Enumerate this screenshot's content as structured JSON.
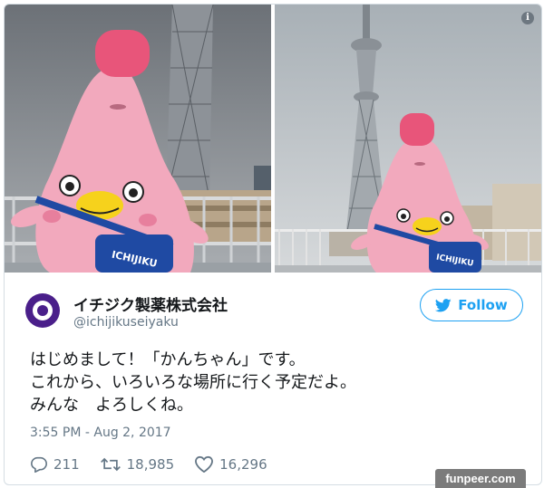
{
  "tweet": {
    "display_name": "イチジク製薬株式会社",
    "handle": "@ichijikuseiyaku",
    "follow_label": "Follow",
    "text_lines": [
      "はじめまして！「かんちゃん」です。",
      "これから、いろいろな場所に行く予定だよ。",
      "みんな　よろしくね。"
    ],
    "timestamp": "3:55 PM - Aug 2, 2017",
    "replies": "211",
    "retweets": "18,985",
    "likes": "16,296"
  },
  "photos": {
    "mascot_bag_text": "ICHIJIKU",
    "info_icon": "i"
  },
  "watermark": "funpeer.com",
  "icons": [
    "info-icon",
    "brand-logo",
    "twitter-bird-icon",
    "reply-icon",
    "retweet-icon",
    "like-icon"
  ],
  "colors": {
    "accent": "#1da1f2",
    "mascot_pink": "#f2a9bd",
    "hat_pink": "#e8557a",
    "bag_blue": "#1f4aa3",
    "text": "#14171a",
    "muted": "#657786"
  }
}
